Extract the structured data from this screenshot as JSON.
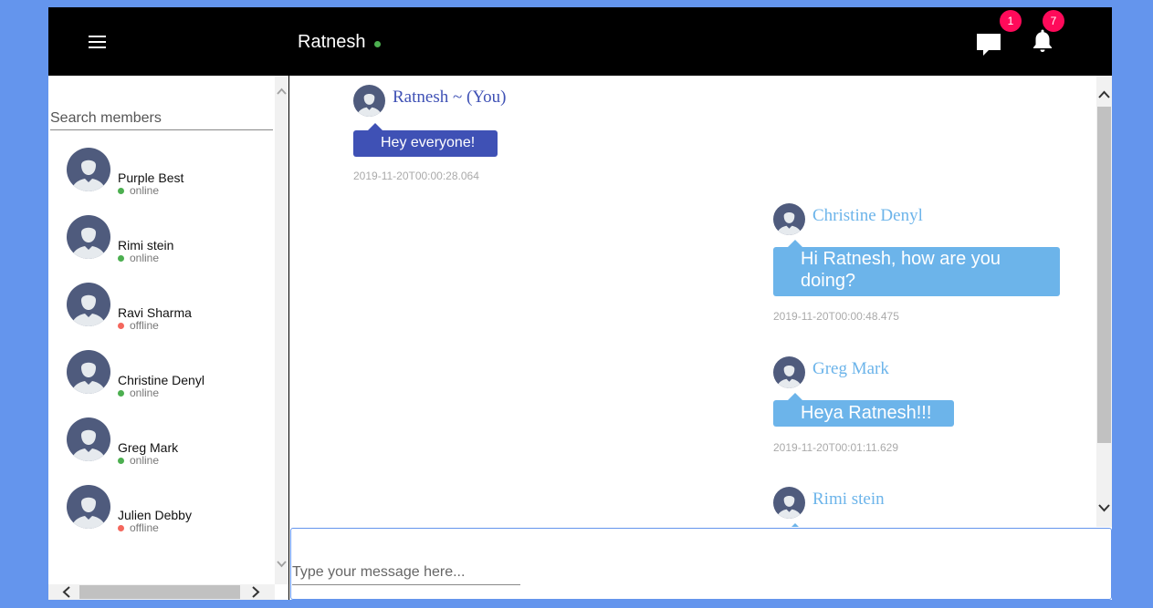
{
  "header": {
    "title": "Ratnesh",
    "status_color": "#4caf50",
    "icons": [
      "menu-icon",
      "chat-icon",
      "bell-icon"
    ],
    "chat_badge": "1",
    "notification_badge": "7"
  },
  "sidebar": {
    "search_placeholder": "Search members",
    "members": [
      {
        "name": "Purple Best",
        "status": "online"
      },
      {
        "name": "Rimi stein",
        "status": "online"
      },
      {
        "name": "Ravi Sharma",
        "status": "offline"
      },
      {
        "name": "Christine Denyl",
        "status": "online"
      },
      {
        "name": "Greg Mark",
        "status": "online"
      },
      {
        "name": "Julien Debby",
        "status": "offline"
      }
    ],
    "status_colors": {
      "online": "#4caf50",
      "offline": "#f4675d"
    }
  },
  "messages": [
    {
      "sender": "Ratnesh ~ (You)",
      "text": "Hey everyone!",
      "timestamp": "2019-11-20T00:00:28.064",
      "self": true
    },
    {
      "sender": "Christine Denyl",
      "text": "Hi Ratnesh, how are you doing?",
      "timestamp": "2019-11-20T00:00:48.475",
      "self": false
    },
    {
      "sender": "Greg Mark",
      "text": "Heya Ratnesh!!!",
      "timestamp": "2019-11-20T00:01:11.629",
      "self": false
    },
    {
      "sender": "Rimi stein",
      "text": "",
      "timestamp": "",
      "self": false
    }
  ],
  "colors": {
    "self_bubble": "#3f51b5",
    "other_bubble": "#6cb4ea",
    "page_background": "#6495ed",
    "header_background": "#000000",
    "badge": "#ff0a5a"
  },
  "composer": {
    "placeholder": "Type your message here..."
  }
}
